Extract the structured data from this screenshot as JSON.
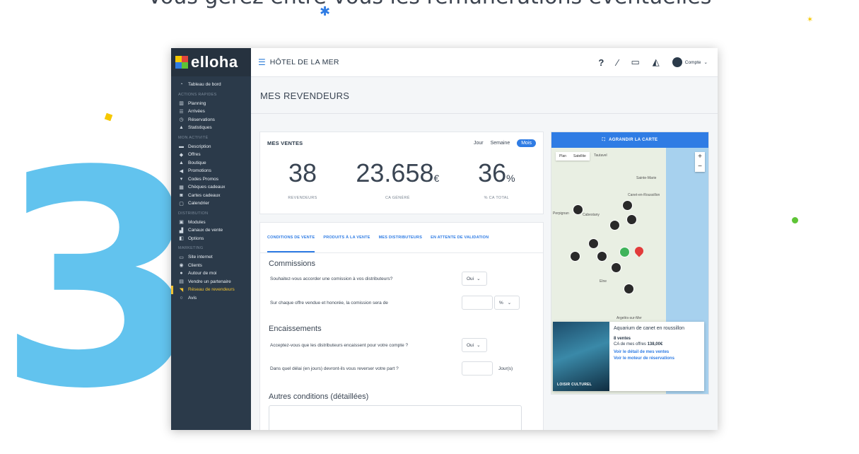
{
  "hero": {
    "title": "Vous gérez entre vous les rémunérations éventuelles",
    "step_number": "3"
  },
  "colors": {
    "accent_blue": "#2f7ce4",
    "sidebar_bg": "#2b3a4a",
    "active_yellow": "#f2c230",
    "step_cyan": "#62c3ee"
  },
  "app": {
    "brand": "elloha",
    "hotel": "HÔTEL DE LA MER",
    "account_label": "Compte",
    "page_title": "MES REVENDEURS"
  },
  "sidebar": {
    "items": [
      {
        "type": "item",
        "label": "Tableau de bord",
        "icon": "dashboard-icon",
        "glyph": "◔"
      },
      {
        "type": "section",
        "label": "ACTIONS RAPIDES"
      },
      {
        "type": "item",
        "label": "Planning",
        "icon": "chart-icon",
        "glyph": "▥"
      },
      {
        "type": "item",
        "label": "Arrivées",
        "icon": "sliders-icon",
        "glyph": "☰"
      },
      {
        "type": "item",
        "label": "Réservations",
        "icon": "clock-icon",
        "glyph": "◷"
      },
      {
        "type": "item",
        "label": "Statistiques",
        "icon": "stats-icon",
        "glyph": "▲"
      },
      {
        "type": "section",
        "label": "MON ACTIVITÉ"
      },
      {
        "type": "item",
        "label": "Description",
        "icon": "briefcase-icon",
        "glyph": "▬"
      },
      {
        "type": "item",
        "label": "Offres",
        "icon": "tag-icon",
        "glyph": "◆"
      },
      {
        "type": "item",
        "label": "Boutique",
        "icon": "bag-icon",
        "glyph": "▲"
      },
      {
        "type": "item",
        "label": "Promotions",
        "icon": "megaphone-icon",
        "glyph": "◀"
      },
      {
        "type": "item",
        "label": "Codes Promos",
        "icon": "cart-icon",
        "glyph": "▾"
      },
      {
        "type": "item",
        "label": "Chèques cadeaux",
        "icon": "ticket-icon",
        "glyph": "▦"
      },
      {
        "type": "item",
        "label": "Cartes cadeaux",
        "icon": "gift-icon",
        "glyph": "◙"
      },
      {
        "type": "item",
        "label": "Calendrier",
        "icon": "calendar-icon",
        "glyph": "▢"
      },
      {
        "type": "section",
        "label": "DISTRIBUTION"
      },
      {
        "type": "item",
        "label": "Modules",
        "icon": "module-icon",
        "glyph": "▣"
      },
      {
        "type": "item",
        "label": "Canaux de vente",
        "icon": "sitemap-icon",
        "glyph": "▟"
      },
      {
        "type": "item",
        "label": "Options",
        "icon": "options-icon",
        "glyph": "◧"
      },
      {
        "type": "section",
        "label": "MARKETING"
      },
      {
        "type": "item",
        "label": "Site internet",
        "icon": "laptop-icon",
        "glyph": "▭"
      },
      {
        "type": "item",
        "label": "Clients",
        "icon": "users-icon",
        "glyph": "◉"
      },
      {
        "type": "item",
        "label": "Autour de moi",
        "icon": "location-pin-icon",
        "glyph": "●"
      },
      {
        "type": "item",
        "label": "Vendre un partenaire",
        "icon": "card-icon",
        "glyph": "▤"
      },
      {
        "type": "item",
        "label": "Réseau de revendeurs",
        "icon": "handshake-icon",
        "glyph": "◥",
        "active": true
      },
      {
        "type": "item",
        "label": "Avis",
        "icon": "comment-icon",
        "glyph": "○"
      }
    ]
  },
  "ventes": {
    "title": "MES VENTES",
    "periods": [
      "Jour",
      "Semaine",
      "Mois"
    ],
    "stats": [
      {
        "value": "38",
        "unit": "",
        "label": "REVENDEURS"
      },
      {
        "value": "23.658",
        "unit": "€",
        "label": "CA GÉNÉRÉ"
      },
      {
        "value": "36",
        "unit": "%",
        "label": "% CA TOTAL"
      }
    ]
  },
  "tabs": [
    "CONDITIONS DE VENTE",
    "PRODUITS À LA VENTE",
    "MES DISTRIBUTEURS",
    "EN ATTENTE DE VALIDATION"
  ],
  "form": {
    "commissions_title": "Commissions",
    "q1": "Souhaitez-vous accorder une comission à vos distributeurs?",
    "q1_value": "Oui",
    "q2": "Sur chaque offre vendue et honorée, la comission sera de",
    "q2_unit": "%",
    "encaissements_title": "Encaissements",
    "q3": "Acceptez-vous que les distributeurs encaissent pour votre compte ?",
    "q3_value": "Oui",
    "q4": "Dans quel délai (en jours) devront-ils vous reverser votre part ?",
    "q4_unit": "Jour(s)",
    "autres_title": "Autres conditions (détaillées)"
  },
  "map": {
    "expand_label": "AGRANDIR LA CARTE",
    "type_plan": "Plan",
    "type_sat": "Satellite",
    "towns": [
      "Tautavel",
      "Sainte-Marie",
      "Canet-en-Roussillon",
      "Perpignan",
      "Cabestany",
      "Elne",
      "Argelès-sur-Mer"
    ],
    "info": {
      "badge": "LOISIR CULTUREL",
      "name": "Aquarium de canet en roussillon",
      "sales_label": "8 ventes",
      "ca_label": "CA de mes offres",
      "ca_value": "138,00€",
      "link1": "Voir le détail de mes ventes",
      "link2": "Voir le moteur de réservations"
    }
  }
}
